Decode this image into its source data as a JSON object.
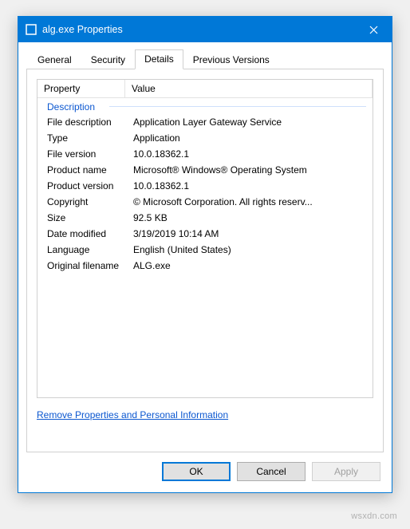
{
  "window": {
    "title": "alg.exe Properties"
  },
  "tabs": {
    "general": "General",
    "security": "Security",
    "details": "Details",
    "previous": "Previous Versions",
    "active": "details"
  },
  "columns": {
    "property": "Property",
    "value": "Value"
  },
  "group": "Description",
  "rows": {
    "file_description": {
      "label": "File description",
      "value": "Application Layer Gateway Service"
    },
    "type": {
      "label": "Type",
      "value": "Application"
    },
    "file_version": {
      "label": "File version",
      "value": "10.0.18362.1"
    },
    "product_name": {
      "label": "Product name",
      "value": "Microsoft® Windows® Operating System"
    },
    "product_version": {
      "label": "Product version",
      "value": "10.0.18362.1"
    },
    "copyright": {
      "label": "Copyright",
      "value": "© Microsoft Corporation. All rights reserv..."
    },
    "size": {
      "label": "Size",
      "value": "92.5 KB"
    },
    "date_modified": {
      "label": "Date modified",
      "value": "3/19/2019 10:14 AM"
    },
    "language": {
      "label": "Language",
      "value": "English (United States)"
    },
    "original_filename": {
      "label": "Original filename",
      "value": "ALG.exe"
    }
  },
  "link": "Remove Properties and Personal Information",
  "buttons": {
    "ok": "OK",
    "cancel": "Cancel",
    "apply": "Apply"
  },
  "watermark": "wsxdn.com"
}
